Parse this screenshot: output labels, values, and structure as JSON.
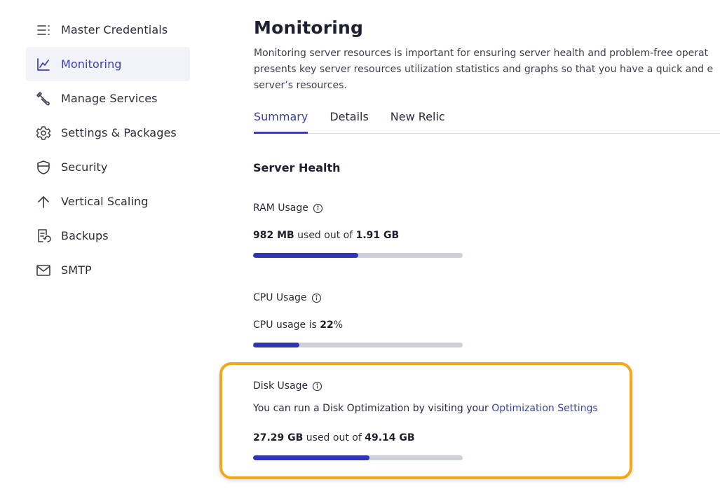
{
  "sidebar": {
    "items": [
      {
        "label": "Master Credentials",
        "icon": "list-icon"
      },
      {
        "label": "Monitoring",
        "icon": "chart-line-icon",
        "active": true
      },
      {
        "label": "Manage Services",
        "icon": "wrench-icon"
      },
      {
        "label": "Settings & Packages",
        "icon": "gear-icon"
      },
      {
        "label": "Security",
        "icon": "shield-icon"
      },
      {
        "label": "Vertical Scaling",
        "icon": "arrow-up-icon"
      },
      {
        "label": "Backups",
        "icon": "backup-file-icon"
      },
      {
        "label": "SMTP",
        "icon": "mail-icon"
      }
    ]
  },
  "main": {
    "title": "Monitoring",
    "description_lines": [
      "Monitoring server resources is important for ensuring server health and problem-free operat",
      "presents key server resources utilization statistics and graphs so that you have a quick and e",
      "server’s resources."
    ],
    "tabs": [
      {
        "label": "Summary",
        "active": true
      },
      {
        "label": "Details"
      },
      {
        "label": "New Relic"
      }
    ],
    "section_title": "Server Health",
    "ram": {
      "label": "RAM Usage",
      "used": "982 MB",
      "middle": " used out of ",
      "total": "1.91 GB",
      "fraction": 0.5
    },
    "cpu": {
      "label": "CPU Usage",
      "prefix": "CPU usage is ",
      "value": "22",
      "suffix": "%",
      "fraction": 0.22
    },
    "disk": {
      "label": "Disk Usage",
      "note_prefix": "You can run a Disk Optimization by visiting your ",
      "note_link": "Optimization Settings",
      "used": "27.29 GB",
      "middle": " used out of ",
      "total": "49.14 GB",
      "fraction": 0.555
    }
  },
  "colors": {
    "accent": "#3b3fb0",
    "bar_fill": "#2f35b5",
    "bar_track": "#cfd1da",
    "highlight": "#f2a81d"
  }
}
